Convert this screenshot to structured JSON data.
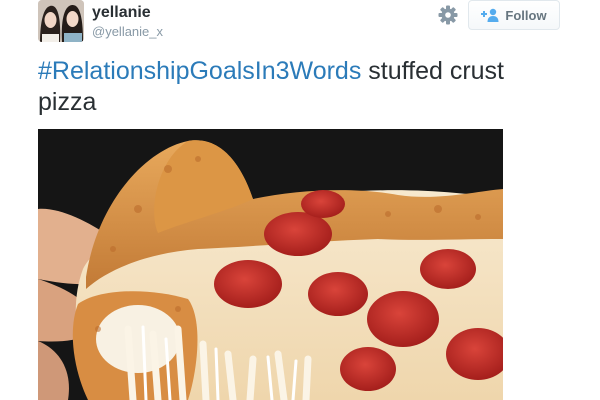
{
  "user": {
    "display_name": "yellanie",
    "handle": "@yellanie_x"
  },
  "actions": {
    "settings_icon": "gear-icon",
    "follow_icon": "add-user-icon",
    "follow_label": "Follow"
  },
  "tweet": {
    "hashtag": "#RelationshipGoalsIn3Words",
    "text": " stuffed crust pizza"
  },
  "colors": {
    "link": "#2b7bb9",
    "text": "#292f33",
    "muted": "#8899a6",
    "follow_text": "#66757f"
  }
}
